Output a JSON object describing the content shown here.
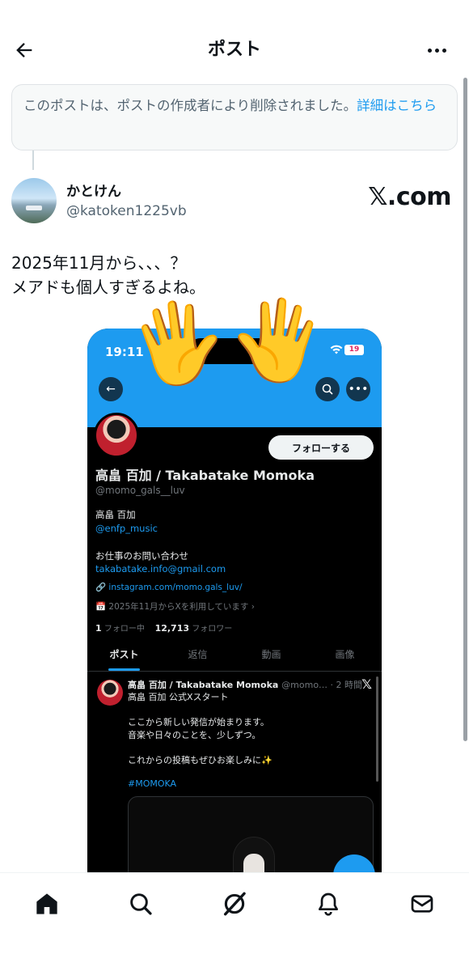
{
  "header": {
    "title": "ポスト"
  },
  "deleted_notice": {
    "text": "このポストは、ポストの作成者により削除されました。",
    "link": "詳細はこちら"
  },
  "author": {
    "display_name": "かとけん",
    "handle": "@katoken1225vb"
  },
  "brand_logo": "𝕏.com",
  "tweet": {
    "text": "2025年11月から、、、？\nメアドも個人すぎるよね。"
  },
  "embedded_screenshot": {
    "status_time": "19:11",
    "battery": "19",
    "follow_button": "フォローする",
    "profile_name": "高畠 百加 / Takabatake Momoka",
    "profile_handle": "@momo_gals__luv",
    "bio_name": "高畠 百加",
    "bio_mention": "@enfp_music",
    "bio_contact_label": "お仕事のお問い合わせ",
    "bio_email": "takabatake.info@gmail.com",
    "bio_link": "instagram.com/momo.gals_luv/",
    "joined": "2025年11月からXを利用しています",
    "following_count": "1",
    "following_label": "フォロー中",
    "followers_count": "12,713",
    "followers_label": "フォロワー",
    "tabs": [
      "ポスト",
      "返信",
      "動画",
      "画像"
    ],
    "post": {
      "author": "高畠 百加 / Takabatake Momoka",
      "meta": "@momo… · 2 時間",
      "line1": "高畠 百加 公式Xスタート",
      "line2": "ここから新しい発信が始まります。",
      "line3": "音楽や日々のことを、少しずつ。",
      "line4": "これからの投稿もぜひお楽しみに✨",
      "hashtag": "#MOMOKA"
    }
  },
  "icons": {
    "back": "arrow-left-icon",
    "more": "more-dots-icon",
    "home": "home-icon",
    "search": "search-icon",
    "grok": "grok-icon",
    "notifications": "bell-icon",
    "messages": "mail-icon"
  },
  "colors": {
    "accent": "#1d9bf0",
    "text": "#0f1419",
    "secondary": "#536471"
  }
}
